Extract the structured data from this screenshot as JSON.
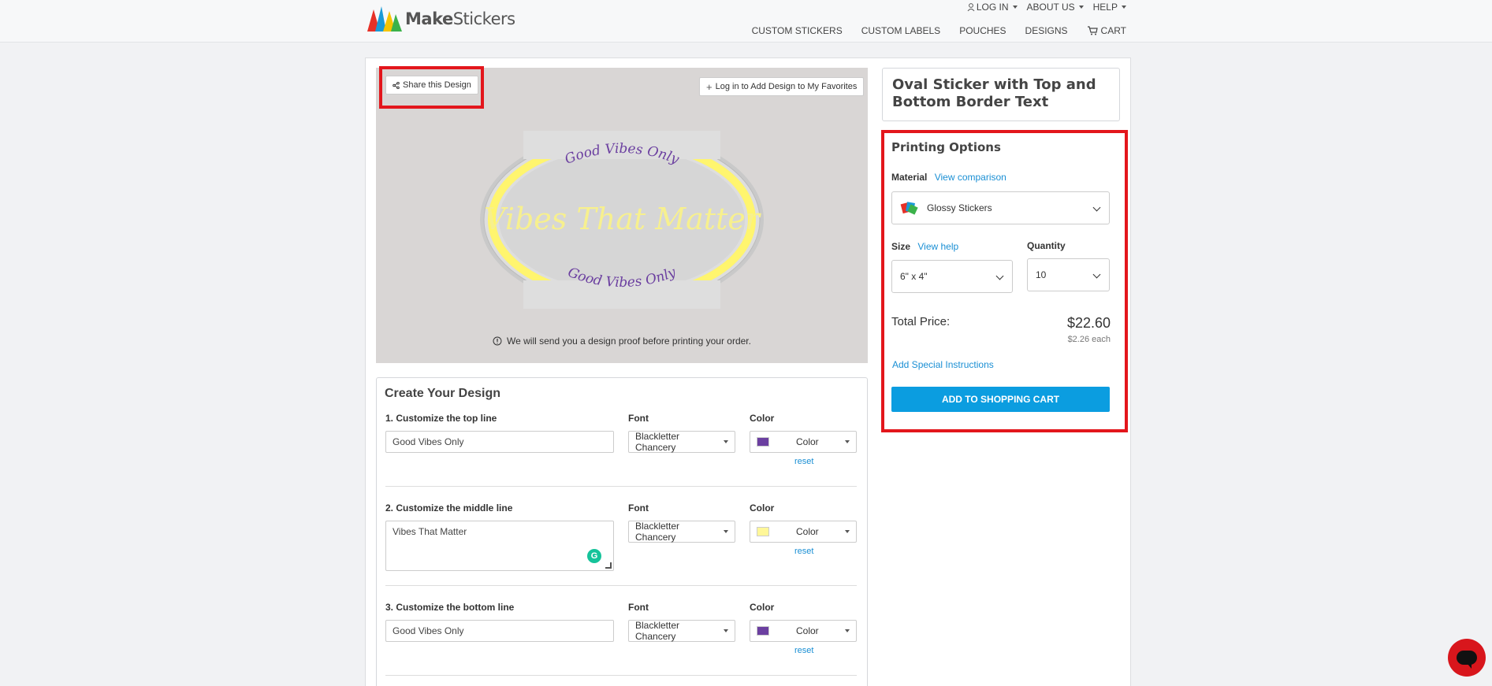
{
  "brand": {
    "name_bold": "Make",
    "name_light": "Stickers"
  },
  "topnav": {
    "login": "LOG IN",
    "about": "ABOUT US",
    "help": "HELP"
  },
  "mainnav": [
    "CUSTOM STICKERS",
    "CUSTOM LABELS",
    "POUCHES",
    "DESIGNS",
    "CART"
  ],
  "preview": {
    "share_label": "Share this Design",
    "favorites_label": "Log in to Add Design to My Favorites",
    "proof_note": "We will send you a design proof before printing your order.",
    "sticker_top_text": "Good Vibes Only",
    "sticker_middle_text": "Vibes That Matter",
    "sticker_bottom_text": "Good Vibes Only"
  },
  "design": {
    "title": "Create Your Design",
    "font_header": "Font",
    "color_header": "Color",
    "reset_label": "reset",
    "lines": [
      {
        "label": "1. Customize the top line",
        "value": "Good Vibes Only",
        "font": "Blackletter Chancery",
        "color_label": "Color",
        "color": "#6b3fa0"
      },
      {
        "label": "2. Customize the middle line",
        "value": "Vibes That Matter",
        "font": "Blackletter Chancery",
        "color_label": "Color",
        "color": "#fff799"
      },
      {
        "label": "3. Customize the bottom line",
        "value": "Good Vibes Only",
        "font": "Blackletter Chancery",
        "color_label": "Color",
        "color": "#6b3fa0"
      }
    ]
  },
  "product": {
    "title": "Oval Sticker with Top and Bottom Border Text",
    "printing_title": "Printing Options",
    "material_label": "Material",
    "material_link": "View comparison",
    "material_value": "Glossy Stickers",
    "size_label": "Size",
    "size_link": "View help",
    "size_value": "6\" x 4\"",
    "quantity_label": "Quantity",
    "quantity_value": "10",
    "total_label": "Total Price:",
    "total_value": "$22.60",
    "each_value": "$2.26 each",
    "special_link": "Add Special Instructions",
    "cart_button": "ADD TO SHOPPING CART"
  },
  "colors": {
    "accent": "#0b9de0",
    "highlight": "#e3161c",
    "link": "#1a8fd4"
  }
}
